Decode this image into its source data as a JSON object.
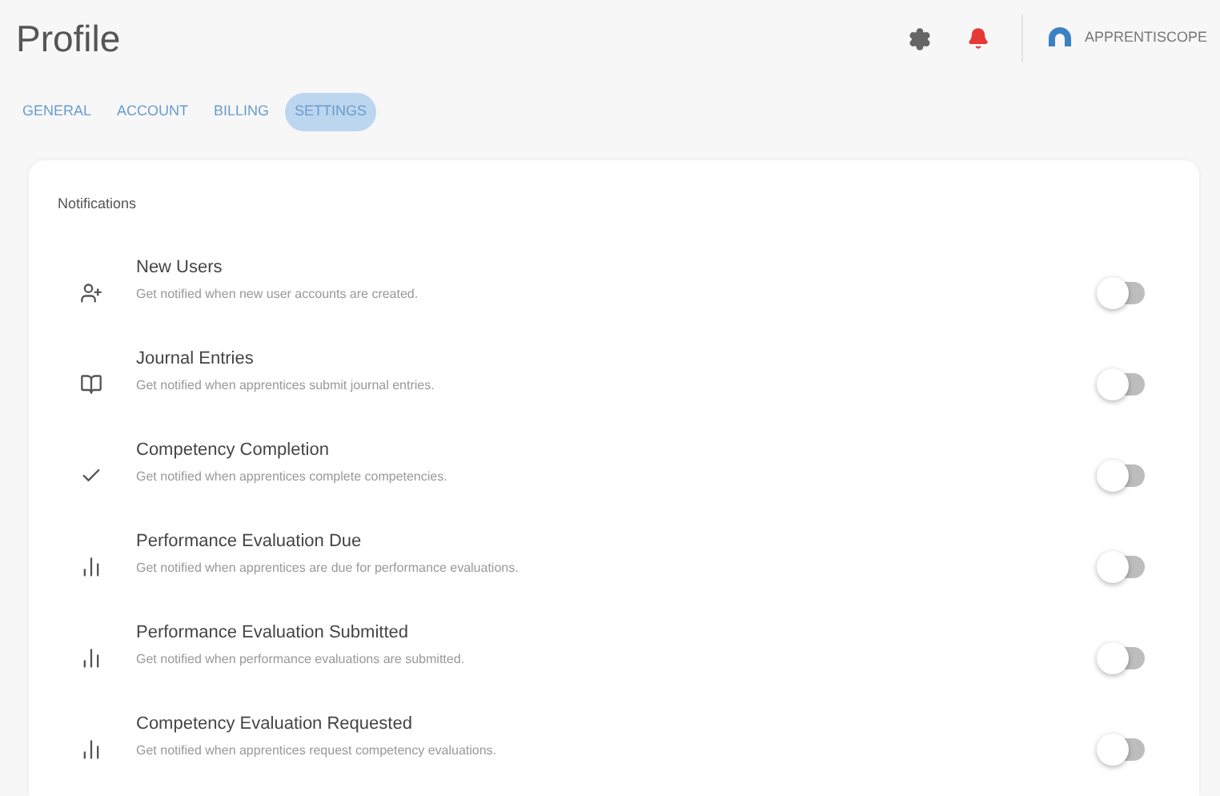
{
  "header": {
    "title": "Profile",
    "brand": "APPRENTISCOPE",
    "alert": true
  },
  "tabs": [
    {
      "label": "GENERAL",
      "selected": false
    },
    {
      "label": "ACCOUNT",
      "selected": false
    },
    {
      "label": "BILLING",
      "selected": false
    },
    {
      "label": "SETTINGS",
      "selected": true
    }
  ],
  "section": {
    "title": "Notifications"
  },
  "notifications": [
    {
      "title": "New Users",
      "description": "Get notified when new user accounts are created.",
      "on": false
    },
    {
      "title": "Journal Entries",
      "description": "Get notified when apprentices submit journal entries.",
      "on": false
    },
    {
      "title": "Competency Completion",
      "description": "Get notified when apprentices complete competencies.",
      "on": false
    },
    {
      "title": "Performance Evaluation Due",
      "description": "Get notified when apprentices are due for performance evaluations.",
      "on": false
    },
    {
      "title": "Performance Evaluation Submitted",
      "description": "Get notified when performance evaluations are submitted.",
      "on": false
    },
    {
      "title": "Competency Evaluation Requested",
      "description": "Get notified when apprentices request competency evaluations.",
      "on": false
    }
  ]
}
